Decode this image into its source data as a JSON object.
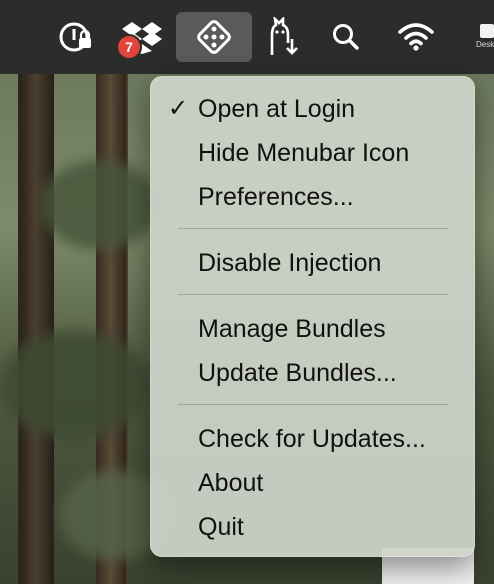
{
  "menubar": {
    "badge_count": "7",
    "desktop_label": "Desk",
    "icons": [
      "1password-icon",
      "dropbox-icon",
      "app-dice-icon",
      "alpaca-download-icon",
      "search-icon",
      "wifi-icon",
      "desktop-icon"
    ]
  },
  "menu": {
    "items": [
      {
        "label": "Open at Login",
        "checked": true
      },
      {
        "label": "Hide Menubar Icon"
      },
      {
        "label": "Preferences..."
      },
      {
        "label": "Disable Injection"
      },
      {
        "label": "Manage Bundles"
      },
      {
        "label": "Update Bundles..."
      },
      {
        "label": "Check for Updates..."
      },
      {
        "label": "About"
      },
      {
        "label": "Quit"
      }
    ],
    "check_glyph": "✓"
  }
}
